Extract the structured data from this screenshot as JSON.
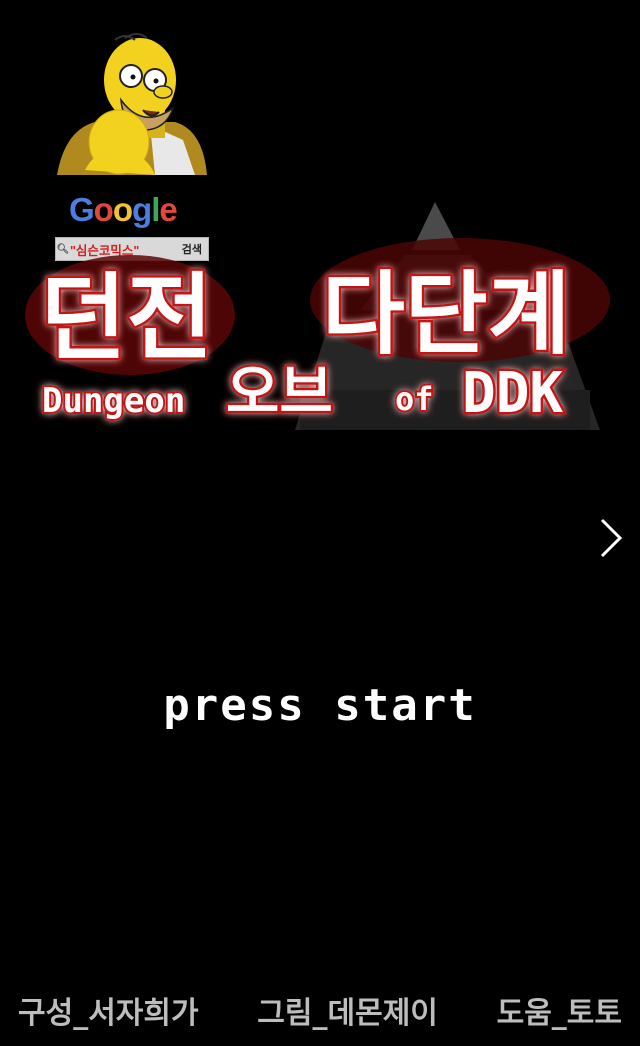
{
  "watermark": {
    "brand": "Google",
    "search_query": "\"심슨코믹스\"",
    "search_button": "검색",
    "search_icon": "magnifier-icon"
  },
  "logo": {
    "title_korean_left": "던전",
    "title_korean_right": "다단계",
    "subtitle_dungeon": "Dungeon",
    "subtitle_korean": "오브",
    "subtitle_of": "of",
    "subtitle_ddk": "DDK",
    "colors": {
      "fill": "#ffffff",
      "outline": "#c21414",
      "glow": "#7a0a0a",
      "pyramid": "#3a3a3a"
    }
  },
  "navigation": {
    "next_icon": "chevron-right-icon"
  },
  "main": {
    "press_start": "press start"
  },
  "credits": {
    "composition": "구성_서자희가",
    "art": "그림_데몬제이",
    "help": "도움_토토"
  }
}
